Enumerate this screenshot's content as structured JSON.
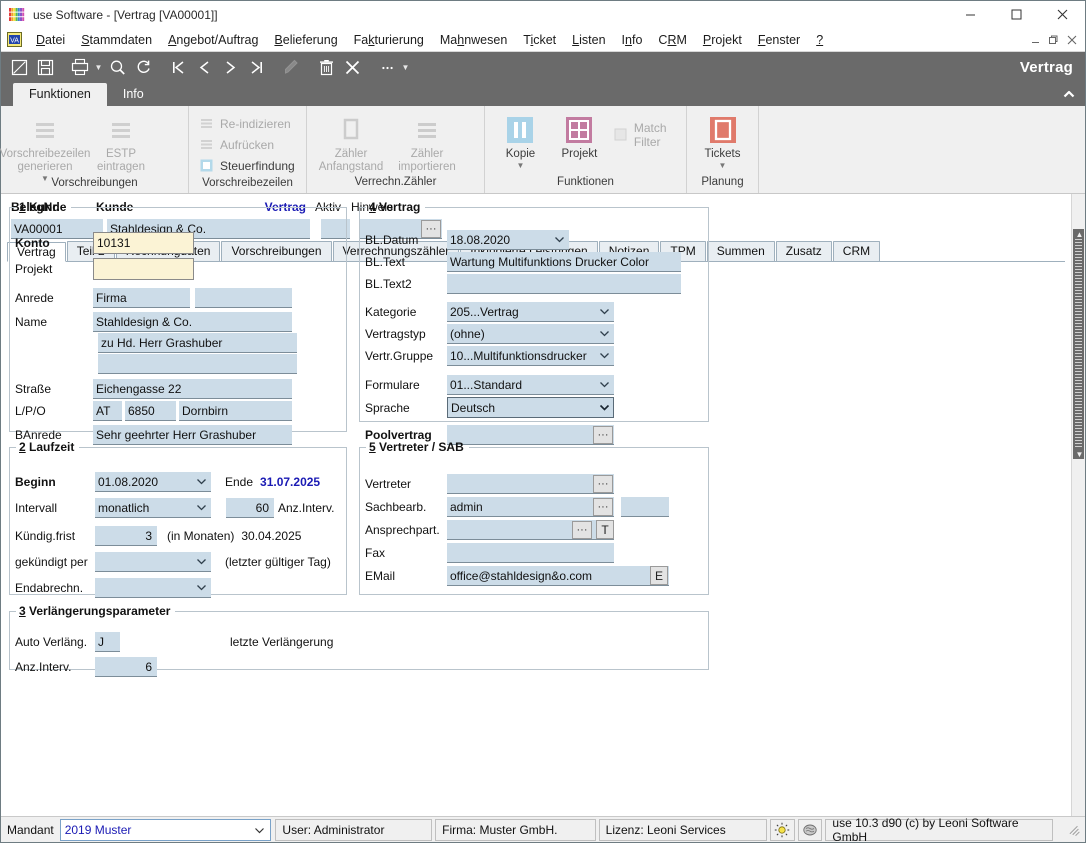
{
  "window": {
    "title": "use Software - [Vertrag [VA00001]]",
    "minimize": "–",
    "maximize": "☐",
    "close": "✕",
    "mdi_minimize": "–",
    "mdi_restore": "❐",
    "mdi_close": "✕"
  },
  "menubar": {
    "items": [
      {
        "label": "Datei",
        "accel": "D"
      },
      {
        "label": "Stammdaten",
        "accel": "S"
      },
      {
        "label": "Angebot/Auftrag",
        "accel": "A"
      },
      {
        "label": "Belieferung",
        "accel": "B"
      },
      {
        "label": "Fakturierung",
        "accel": "k"
      },
      {
        "label": "Mahnwesen",
        "accel": "h"
      },
      {
        "label": "Ticket",
        "accel": "i"
      },
      {
        "label": "Listen",
        "accel": "L"
      },
      {
        "label": "Info",
        "accel": "n"
      },
      {
        "label": "CRM",
        "accel": "R"
      },
      {
        "label": "Projekt",
        "accel": "P"
      },
      {
        "label": "Fenster",
        "accel": "F"
      },
      {
        "label": "?",
        "accel": "?"
      }
    ]
  },
  "toolbar": {
    "document_title": "Vertrag",
    "buttons": [
      {
        "name": "new-record-button",
        "icon": "new-document-icon",
        "enabled": true
      },
      {
        "name": "save-button",
        "icon": "save-disk-icon",
        "enabled": true
      },
      {
        "name": "print-button",
        "icon": "printer-icon",
        "enabled": true
      },
      {
        "name": "print-dropdown",
        "icon": "caret-down-icon",
        "enabled": true
      },
      {
        "name": "search-button",
        "icon": "magnifier-icon",
        "enabled": true
      },
      {
        "name": "refresh-button",
        "icon": "refresh-icon",
        "enabled": true
      },
      {
        "name": "first-record-button",
        "icon": "first-record-icon",
        "enabled": true
      },
      {
        "name": "previous-record-button",
        "icon": "previous-record-icon",
        "enabled": true
      },
      {
        "name": "next-record-button",
        "icon": "next-record-icon",
        "enabled": true
      },
      {
        "name": "last-record-button",
        "icon": "last-record-icon",
        "enabled": true
      },
      {
        "name": "edit-button",
        "icon": "pencil-icon",
        "enabled": false
      },
      {
        "name": "delete-button",
        "icon": "trash-icon",
        "enabled": true
      },
      {
        "name": "cancel-button",
        "icon": "x-cross-icon",
        "enabled": true
      },
      {
        "name": "more-button",
        "icon": "ellipsis-icon",
        "enabled": true
      },
      {
        "name": "more-dropdown",
        "icon": "caret-down-icon",
        "enabled": true
      }
    ]
  },
  "ribbon": {
    "collapse_icon": "chevron-up-icon",
    "tabs": [
      {
        "label": "Funktionen",
        "active": true
      },
      {
        "label": "Info",
        "active": false
      }
    ],
    "groups": [
      {
        "name": "Vorschreibungen",
        "label": "Vorschreibungen",
        "buttons": [
          {
            "label": "Vorschreibezeilen\ngenerieren",
            "enabled": false,
            "dropdown": true,
            "icon": "lines-icon",
            "color": "#c9c9c9"
          },
          {
            "label": "ESTP\neintragen",
            "enabled": false,
            "dropdown": false,
            "icon": "lines-icon",
            "color": "#c9c9c9"
          }
        ]
      },
      {
        "name": "Vorschreibezeilen",
        "label": "Vorschreibezeilen",
        "small_buttons": [
          {
            "label": "Re-indizieren",
            "enabled": false,
            "icon": "lines-icon"
          },
          {
            "label": "Aufrücken",
            "enabled": false,
            "icon": "lines-icon"
          },
          {
            "label": "Steuerfindung",
            "enabled": true,
            "icon": "blue-square-icon"
          }
        ]
      },
      {
        "name": "Verrechn.Zaehler",
        "label": "Verrechn.Zähler",
        "buttons": [
          {
            "label": "Zähler\nAnfangstand",
            "enabled": false,
            "dropdown": false,
            "icon": "rect-icon",
            "color": "#cccccc"
          },
          {
            "label": "Zähler\nimportieren",
            "enabled": false,
            "dropdown": false,
            "icon": "lines-icon",
            "color": "#cccccc"
          }
        ]
      },
      {
        "name": "Funktionen",
        "label": "Funktionen",
        "buttons": [
          {
            "label": "Kopie",
            "enabled": true,
            "dropdown": true,
            "icon": "pause-bars-icon",
            "color": "#a9d3e8"
          },
          {
            "label": "Projekt",
            "enabled": true,
            "dropdown": false,
            "icon": "grid-icon",
            "color": "#c27ba0"
          }
        ],
        "checkbox": {
          "label": "Match Filter",
          "checked": false,
          "enabled": false
        }
      },
      {
        "name": "Planung",
        "label": "Planung",
        "buttons": [
          {
            "label": "Tickets",
            "enabled": true,
            "dropdown": true,
            "icon": "rect-icon",
            "color": "#e07a6b"
          }
        ]
      }
    ]
  },
  "record_header": {
    "belegnr_label": "BelegNr.",
    "belegnr_value": "VA00001",
    "kunde_label": "Kunde",
    "kunde_value": "Stahldesign & Co.",
    "vertrag_label": "Vertrag",
    "aktiv_label": "Aktiv",
    "aktiv_value": "",
    "hinweis_label": "Hinweis",
    "hinweis_value": "",
    "hinweis_button": "···"
  },
  "form_tabs": [
    {
      "label": "Vertrag",
      "active": true
    },
    {
      "label": "Teil 2",
      "active": false
    },
    {
      "label": "Rechnungdaten",
      "active": false
    },
    {
      "label": "Vorschreibungen",
      "active": false
    },
    {
      "label": "Verrechnungszähler",
      "active": false
    },
    {
      "label": "Inkludierte Leistungen",
      "active": false
    },
    {
      "label": "Notizen",
      "active": false
    },
    {
      "label": "TPM",
      "active": false
    },
    {
      "label": "Summen",
      "active": false
    },
    {
      "label": "Zusatz",
      "active": false
    },
    {
      "label": "CRM",
      "active": false
    }
  ],
  "group_kunde": {
    "number": "1",
    "title": "Kunde",
    "konto_label": "Konto",
    "konto_value": "10131",
    "projekt_label": "Projekt",
    "projekt_value": "",
    "anrede_label": "Anrede",
    "anrede_value": "Firma",
    "anrede2_value": "",
    "name_label": "Name",
    "name1_value": "Stahldesign & Co.",
    "name2_value": "zu Hd. Herr Grashuber",
    "name3_value": "",
    "strasse_label": "Straße",
    "strasse_value": "Eichengasse 22",
    "lpo_label": "L/P/O",
    "land_value": "AT",
    "plz_value": "6850",
    "ort_value": "Dornbirn",
    "banrede_label": "BAnrede",
    "banrede_value": "Sehr geehrter Herr Grashuber"
  },
  "group_laufzeit": {
    "number": "2",
    "title": "Laufzeit",
    "beginn_label": "Beginn",
    "beginn_value": "01.08.2020",
    "ende_label": "Ende",
    "ende_value": "31.07.2025",
    "intervall_label": "Intervall",
    "intervall_value": "monatlich",
    "anzinterv_value": "60",
    "anzinterv_label": "Anz.Interv.",
    "kuendigfrist_label": "Kündig.frist",
    "kuendigfrist_value": "3",
    "in_monaten_label": "(in Monaten)",
    "kuendig_date": "30.04.2025",
    "gekuendigt_label": "gekündigt per",
    "gekuendigt_value": "",
    "letzter_tag_label": "(letzter gültiger Tag)",
    "endabrechn_label": "Endabrechn.",
    "endabrechn_value": ""
  },
  "group_verlaengerung": {
    "number": "3",
    "title": "Verlängerungsparameter",
    "auto_label": "Auto Verläng.",
    "auto_value": "J",
    "letzte_label": "letzte Verlängerung",
    "anzinterv_label": "Anz.Interv.",
    "anzinterv_value": "6"
  },
  "group_vertrag": {
    "number": "4",
    "title": "Vertrag",
    "bldatum_label": "BL.Datum",
    "bldatum_value": "18.08.2020",
    "bltext_label": "BL.Text",
    "bltext_value": "Wartung Multifunktions Drucker Color",
    "bltext2_label": "BL.Text2",
    "bltext2_value": "",
    "kategorie_label": "Kategorie",
    "kategorie_value": "205...Vertrag",
    "vertragstyp_label": "Vertragstyp",
    "vertragstyp_value": "(ohne)",
    "vertrgruppe_label": "Vertr.Gruppe",
    "vertrgruppe_value": "10...Multifunktionsdrucker",
    "formulare_label": "Formulare",
    "formulare_value": "01...Standard",
    "sprache_label": "Sprache",
    "sprache_value": "Deutsch",
    "poolvertrag_label": "Poolvertrag",
    "poolvertrag_value": "",
    "poolvertrag_button": "···"
  },
  "group_vertreter": {
    "number": "5",
    "title": "Vertreter / SAB",
    "vertreter_label": "Vertreter",
    "vertreter_value": "",
    "vertreter_button": "···",
    "sachbearb_label": "Sachbearb.",
    "sachbearb_value": "admin",
    "sachbearb_button": "···",
    "sachbearb_extra": "",
    "ansprech_label": "Ansprechpart.",
    "ansprech_value": "",
    "ansprech_button": "···",
    "ansprech_t_button": "T",
    "fax_label": "Fax",
    "fax_value": "",
    "email_label": "EMail",
    "email_value": "office@stahldesign&o.com",
    "email_button": "E"
  },
  "statusbar": {
    "mandant_label": "Mandant",
    "mandant_value": "2019 Muster",
    "user": "User: Administrator",
    "firma": "Firma: Muster GmbH.",
    "lizenz": "Lizenz: Leoni Services",
    "icon1": "sun-bulb-icon",
    "icon2": "brain-icon",
    "version": "use 10.3 d90 (c) by Leoni Software GmbH"
  }
}
